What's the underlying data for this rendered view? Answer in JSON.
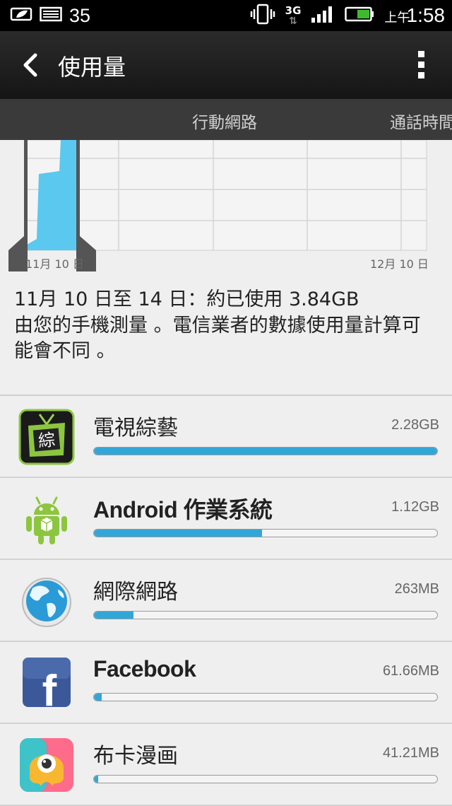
{
  "status_bar": {
    "notification_count": "35",
    "network_type": "3G",
    "ampm": "上午",
    "time": "1:58"
  },
  "action_bar": {
    "title": "使用量"
  },
  "tabs": [
    {
      "label": "行動網路",
      "active": true
    },
    {
      "label": "通話時間",
      "active": false
    }
  ],
  "chart": {
    "start_label": "11月 10 日",
    "end_label": "12月 10 日",
    "fill_color": "#5bc8f0"
  },
  "summary": {
    "line1": "11月 10 日至 14 日：約已使用 3.84GB",
    "line2": "由您的手機測量 。電信業者的數據使用量計算可能會不同 。"
  },
  "apps": [
    {
      "name": "電視綜藝",
      "size": "2.28GB",
      "fraction": 1.0,
      "icon": "tv-variety-icon"
    },
    {
      "name": "Android 作業系統",
      "size": "1.12GB",
      "fraction": 0.49,
      "icon": "android-icon"
    },
    {
      "name": "網際網路",
      "size": "263MB",
      "fraction": 0.115,
      "icon": "globe-icon"
    },
    {
      "name": "Facebook",
      "size": "61.66MB",
      "fraction": 0.022,
      "icon": "facebook-icon"
    },
    {
      "name": "布卡漫画",
      "size": "41.21MB",
      "fraction": 0.012,
      "icon": "buka-manga-icon"
    }
  ],
  "colors": {
    "accent": "#33a6d8",
    "tv_icon_green": "#8cc63f",
    "android_green": "#8cc63f",
    "facebook_blue": "#3b5998"
  },
  "tv_icon_glyph": "綜",
  "facebook_glyph": "f"
}
